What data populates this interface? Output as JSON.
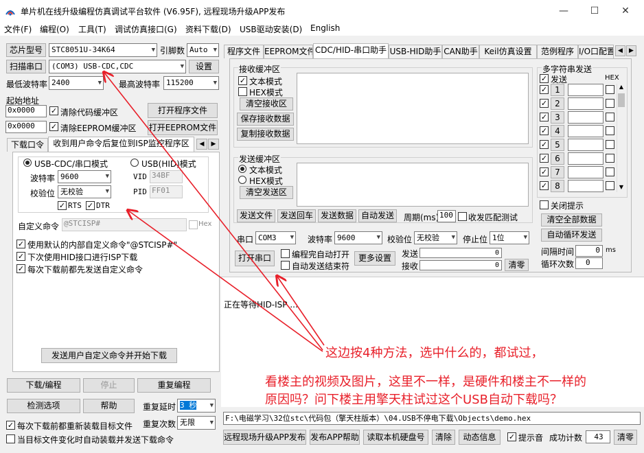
{
  "window": {
    "title": "单片机在线升级编程仿真调试平台软件 (V6.95F), 远程现场升级APP发布",
    "min": "—",
    "max": "☐",
    "close": "✕"
  },
  "menu": [
    "文件(F)",
    "编程(O)",
    "工具(T)",
    "调试仿真接口(G)",
    "资料下载(D)",
    "USB驱动安装(D)",
    "English"
  ],
  "left": {
    "chip_label": "芯片型号",
    "chip_value": "STC8051U-34K64",
    "pin_label": "引脚数",
    "pin_value": "Auto",
    "scan_label": "扫描串口",
    "port_value": "(COM3) USB-CDC,CDC",
    "settings_label": "设置",
    "min_baud_label": "最低波特率",
    "min_baud_value": "2400",
    "max_baud_label": "最高波特率",
    "max_baud_value": "115200",
    "start_addr_label": "起始地址",
    "addr1": "0x0000",
    "clear_code_label": "清除代码缓冲区",
    "open_prog_label": "打开程序文件",
    "addr2": "0x0000",
    "clear_eeprom_label": "清除EEPROM缓冲区",
    "open_eeprom_label": "打开EEPROM文件",
    "tabs": [
      "下载/编程",
      "收到用户命令后复位到ISP监控程序区"
    ],
    "tab_prefix": "下载口令",
    "usb_cdc_label": "USB-CDC/串口模式",
    "usb_hid_label": "USB(HID)模式",
    "baud_label": "波特率",
    "baud_value": "9600",
    "parity_label": "校验位",
    "parity_value": "无校验",
    "vid_label": "VID",
    "vid_value": "34BF",
    "pid_label": "PID",
    "pid_value": "FF01",
    "rts_label": "RTS",
    "dtr_label": "DTR",
    "custom_cmd_label": "自定义命令",
    "custom_cmd_value": "@STCISP#",
    "hex_label": "Hex",
    "opt1": "使用默认的内部自定义命令\"@STCISP#\"",
    "opt2": "下次使用HID接口进行ISP下载",
    "opt3": "每次下载前都先发送自定义命令",
    "send_dl_label": "发送用户自定义命令并开始下载",
    "download_label": "下载/编程",
    "stop_label": "停止",
    "reprog_label": "重复编程",
    "check_label": "检测选项",
    "help_label": "帮助",
    "delay_label": "重复延时",
    "delay_value": "3 秒",
    "count_label": "重复次数",
    "count_value": "无限",
    "reload_label": "每次下载前都重新装载目标文件",
    "autoload_label": "当目标文件变化时自动装载并发送下载命令"
  },
  "right": {
    "tabs": [
      "程序文件",
      "EEPROM文件",
      "CDC/HID-串口助手",
      "USB-HID助手",
      "CAN助手",
      "Keil仿真设置",
      "范例程序",
      "I/O口配置"
    ],
    "recv_title": "接收缓冲区",
    "text_mode": "文本模式",
    "hex_mode": "HEX模式",
    "clear_recv": "清空接收区",
    "save_recv": "保存接收数据",
    "copy_recv": "复制接收数据",
    "send_title": "发送缓冲区",
    "clear_send": "清空发送区",
    "send_file": "发送文件",
    "send_enter": "发送回车",
    "send_data": "发送数据",
    "auto_send": "自动发送",
    "period_label": "周期(ms)",
    "period_value": "100",
    "match_label": "收发匹配测试",
    "multi_title": "多字符串发送",
    "send_col": "发送",
    "hex_col": "HEX",
    "rows": [
      "1",
      "2",
      "3",
      "4",
      "5",
      "6",
      "7",
      "8"
    ],
    "close_hint": "关闭提示",
    "clear_all": "清空全部数据",
    "auto_loop": "自动循环发送",
    "interval_label": "间隔时间",
    "interval_value": "0",
    "ms": "ms",
    "loop_label": "循环次数",
    "loop_value": "0",
    "port_label": "串口",
    "port_value": "COM3",
    "baud_label": "波特率",
    "baud_value": "9600",
    "parity_label": "校验位",
    "parity_value": "无校验",
    "stop_label": "停止位",
    "stop_value": "1位",
    "open_port": "打开串口",
    "auto_open": "编程完自动打开",
    "auto_close": "自动发送结束符",
    "more_settings": "更多设置",
    "sent_label": "发送",
    "sent_value": "0",
    "recv_label": "接收",
    "recv_value": "0",
    "clear_count": "清零"
  },
  "log": {
    "text": "正在等待HID-ISP ...",
    "annotation1": "这边按4种方法，选中什么的，都试过，",
    "annotation2": "看楼主的视频及图片，这里不一样，是硬件和楼主不一样的",
    "annotation3": "原因吗？问下楼主用擎天柱试过这个USB自动下载吗？"
  },
  "bottom": {
    "path": "F:\\电磁学习\\32位stc\\代码包（擎天柱版本）\\04.USB不停电下载\\Objects\\demo.hex",
    "remote_label": "远程现场升级APP发布",
    "publish_help": "发布APP帮助",
    "read_hdd": "读取本机硬盘号",
    "clear_label": "清除",
    "anim_label": "动态信息",
    "beep_label": "提示音",
    "success_label": "成功计数",
    "success_value": "43",
    "zero_label": "清零"
  },
  "colors": {
    "accent": "#0078d7",
    "annotation": "#e8202a",
    "arrow": "#e8202a"
  }
}
